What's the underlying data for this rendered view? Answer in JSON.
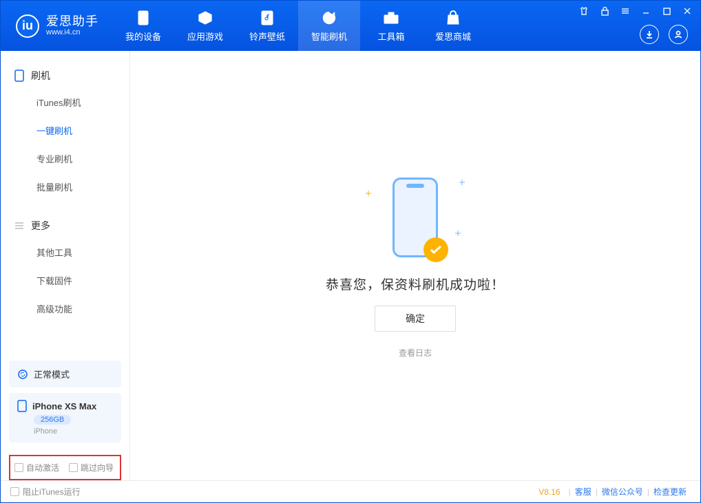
{
  "brand": {
    "title": "爱思助手",
    "subtitle": "www.i4.cn"
  },
  "topnav": {
    "device": "我的设备",
    "apps": "应用游戏",
    "media": "铃声壁纸",
    "flash": "智能刷机",
    "tools": "工具箱",
    "store": "爱思商城"
  },
  "sidebar": {
    "group_flash": "刷机",
    "items_flash": {
      "itunes": "iTunes刷机",
      "oneclick": "一键刷机",
      "pro": "专业刷机",
      "batch": "批量刷机"
    },
    "group_more": "更多",
    "items_more": {
      "other": "其他工具",
      "firmware": "下载固件",
      "advanced": "高级功能"
    }
  },
  "device_card": {
    "mode": "正常模式",
    "name": "iPhone XS Max",
    "storage": "256GB",
    "type": "iPhone"
  },
  "options": {
    "auto_activate": "自动激活",
    "skip_guide": "跳过向导"
  },
  "main": {
    "success_msg": "恭喜您，保资料刷机成功啦！",
    "ok": "确定",
    "view_log": "查看日志"
  },
  "footer": {
    "block_itunes": "阻止iTunes运行",
    "version": "V8.16",
    "support": "客服",
    "wechat": "微信公众号",
    "update": "检查更新"
  }
}
